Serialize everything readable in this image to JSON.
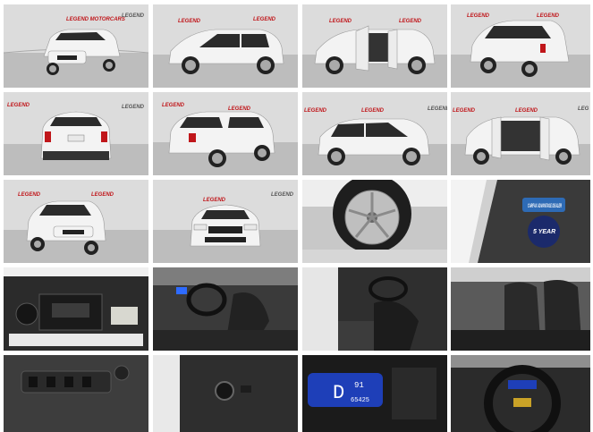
{
  "gallery": {
    "dealer_logo": "LEGEND MOTORCARS",
    "badge_title": "CARFAX ADVANTAGE DEALER",
    "badge_warranty": "5 YEAR",
    "cluster_gear": "D",
    "cluster_reading": "91",
    "cluster_odometer": "65425",
    "colors": {
      "car_body": "#f3f3f3",
      "studio_wall": "#dcdcdc",
      "studio_floor": "#bdbdbd",
      "interior": "#2a2a2a",
      "cluster_glow": "#2e6bff",
      "logo_red": "#c0161a"
    },
    "thumbnails": [
      {
        "name": "front-three-quarter"
      },
      {
        "name": "driver-side-profile"
      },
      {
        "name": "driver-side-doors-open"
      },
      {
        "name": "rear-three-quarter-driver"
      },
      {
        "name": "rear-view"
      },
      {
        "name": "rear-three-quarter-passenger"
      },
      {
        "name": "passenger-side-profile"
      },
      {
        "name": "passenger-side-doors-open"
      },
      {
        "name": "front-three-quarter-passenger"
      },
      {
        "name": "front-view"
      },
      {
        "name": "wheel-closeup"
      },
      {
        "name": "window-sticker-closeup"
      },
      {
        "name": "engine-bay"
      },
      {
        "name": "driver-interior"
      },
      {
        "name": "rear-door-interior"
      },
      {
        "name": "front-seats"
      },
      {
        "name": "door-switch-panel"
      },
      {
        "name": "headlight-switch"
      },
      {
        "name": "instrument-cluster"
      },
      {
        "name": "steering-wheel"
      }
    ]
  }
}
